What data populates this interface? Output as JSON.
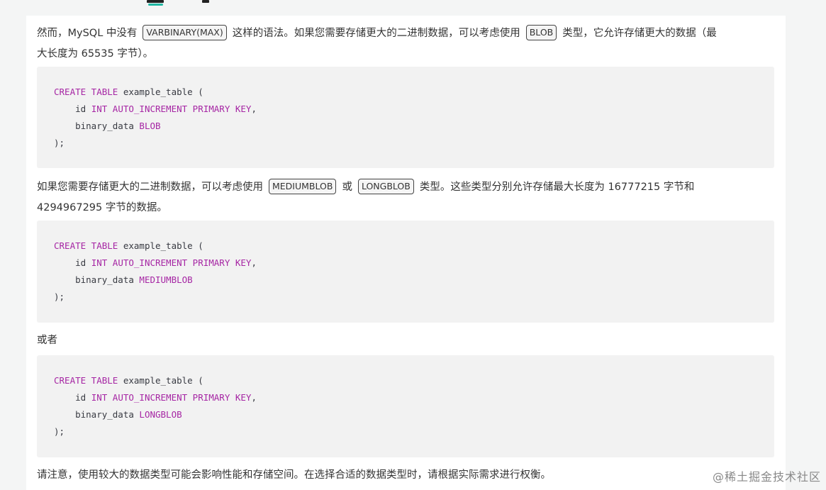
{
  "para1": {
    "t1": "然而，MySQL 中没有",
    "c1": "VARBINARY(MAX)",
    "t2": "这样的语法。如果您需要存储更大的二进制数据，可以考虑使用",
    "c2": "BLOB",
    "t3": "类型，它允许存储更大的数据（最",
    "t4": "大长度为 65535 字节）。"
  },
  "block1": {
    "l1": {
      "k1": "CREATE TABLE",
      "r1": " example_table ("
    },
    "l2": {
      "p": "    id ",
      "k": "INT AUTO_INCREMENT PRIMARY KEY",
      "s": ","
    },
    "l3": {
      "p": "    binary_data ",
      "k": "BLOB"
    },
    "l4": ");"
  },
  "para2": {
    "t1": "如果您需要存储更大的二进制数据，可以考虑使用",
    "c1": "MEDIUMBLOB",
    "t2": "或",
    "c2": "LONGBLOB",
    "t3": "类型。这些类型分别允许存储最大长度为 16777215 字节和",
    "t4": "4294967295 字节的数据。"
  },
  "block2": {
    "l1": {
      "k1": "CREATE TABLE",
      "r1": " example_table ("
    },
    "l2": {
      "p": "    id ",
      "k": "INT AUTO_INCREMENT PRIMARY KEY",
      "s": ","
    },
    "l3": {
      "p": "    binary_data ",
      "k": "MEDIUMBLOB"
    },
    "l4": ");"
  },
  "para3": "或者",
  "block3": {
    "l1": {
      "k1": "CREATE TABLE",
      "r1": " example_table ("
    },
    "l2": {
      "p": "    id ",
      "k": "INT AUTO_INCREMENT PRIMARY KEY",
      "s": ","
    },
    "l3": {
      "p": "    binary_data ",
      "k": "LONGBLOB"
    },
    "l4": ");"
  },
  "para4": "请注意，使用较大的数据类型可能会影响性能和存储空间。在选择合适的数据类型时，请根据实际需求进行权衡。",
  "watermark": "@稀土掘金技术社区",
  "colors": {
    "keyword": "#a626a4",
    "tab_indicator": "#1fb7a3",
    "code_bg": "#f2f2f2"
  }
}
